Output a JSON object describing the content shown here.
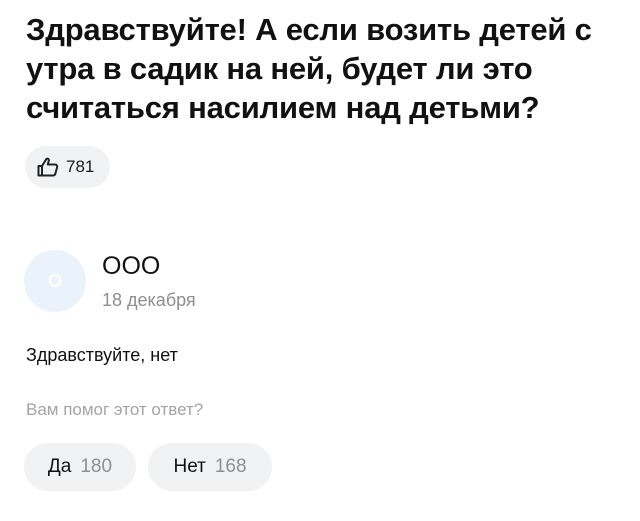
{
  "question": {
    "title": "Здравствуйте! А если возить детей с утра в садик на ней, будет ли это считаться насилием над детьми?",
    "likes": {
      "icon": "thumbs-up-icon",
      "count": "781"
    }
  },
  "answer": {
    "avatar_letter": "О",
    "author": "ООО",
    "date": "18 декабря",
    "text": "Здравствуйте, нет"
  },
  "feedback": {
    "prompt": "Вам помог этот ответ?",
    "yes_label": "Да",
    "yes_count": "180",
    "no_label": "Нет",
    "no_count": "168"
  }
}
